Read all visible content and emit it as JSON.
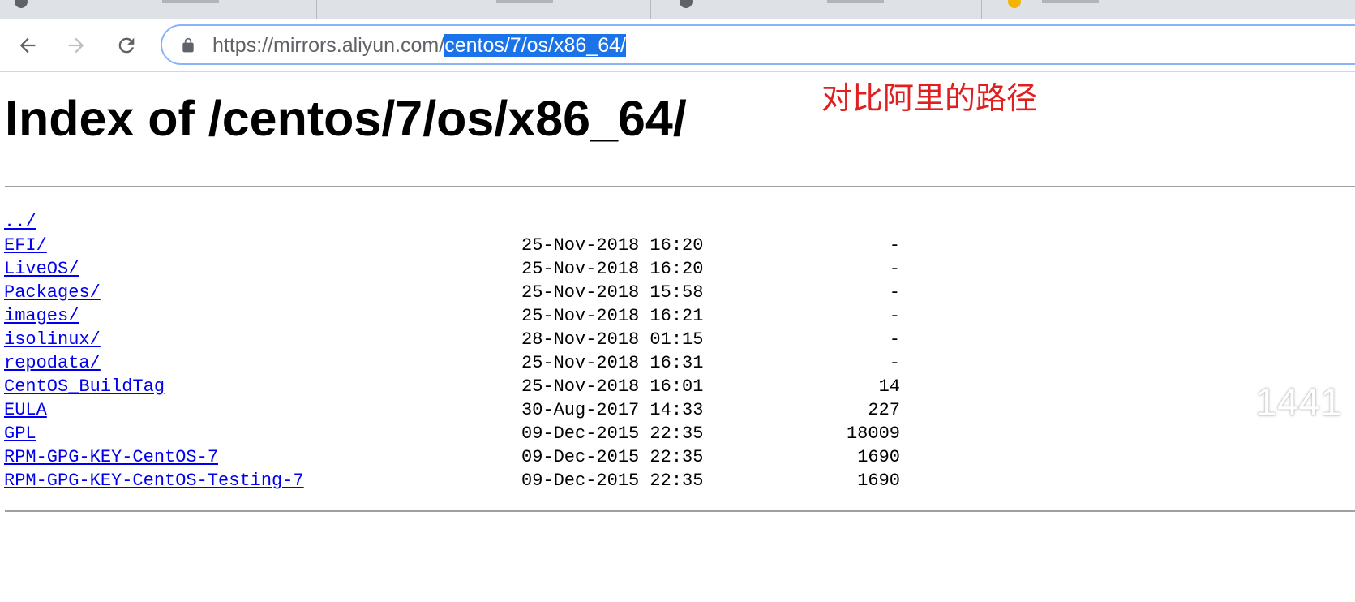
{
  "browser": {
    "address_bar": {
      "url_prefix": "https://mirrors.aliyun.com/",
      "url_selected": "centos/7/os/x86_64/"
    }
  },
  "page": {
    "title": "Index of /centos/7/os/x86_64/",
    "annotation": "对比阿里的路径",
    "entries": [
      {
        "name": "../",
        "date": "",
        "size": ""
      },
      {
        "name": "EFI/",
        "date": "25-Nov-2018 16:20",
        "size": "-"
      },
      {
        "name": "LiveOS/",
        "date": "25-Nov-2018 16:20",
        "size": "-"
      },
      {
        "name": "Packages/",
        "date": "25-Nov-2018 15:58",
        "size": "-"
      },
      {
        "name": "images/",
        "date": "25-Nov-2018 16:21",
        "size": "-"
      },
      {
        "name": "isolinux/",
        "date": "28-Nov-2018 01:15",
        "size": "-"
      },
      {
        "name": "repodata/",
        "date": "25-Nov-2018 16:31",
        "size": "-"
      },
      {
        "name": "CentOS_BuildTag",
        "date": "25-Nov-2018 16:01",
        "size": "14"
      },
      {
        "name": "EULA",
        "date": "30-Aug-2017 14:33",
        "size": "227"
      },
      {
        "name": "GPL",
        "date": "09-Dec-2015 22:35",
        "size": "18009"
      },
      {
        "name": "RPM-GPG-KEY-CentOS-7",
        "date": "09-Dec-2015 22:35",
        "size": "1690"
      },
      {
        "name": "RPM-GPG-KEY-CentOS-Testing-7",
        "date": "09-Dec-2015 22:35",
        "size": "1690"
      }
    ],
    "watermark": "1441"
  },
  "colors": {
    "link": "#0000ee",
    "annotation": "#e02020",
    "selection": "#1a73e8"
  }
}
